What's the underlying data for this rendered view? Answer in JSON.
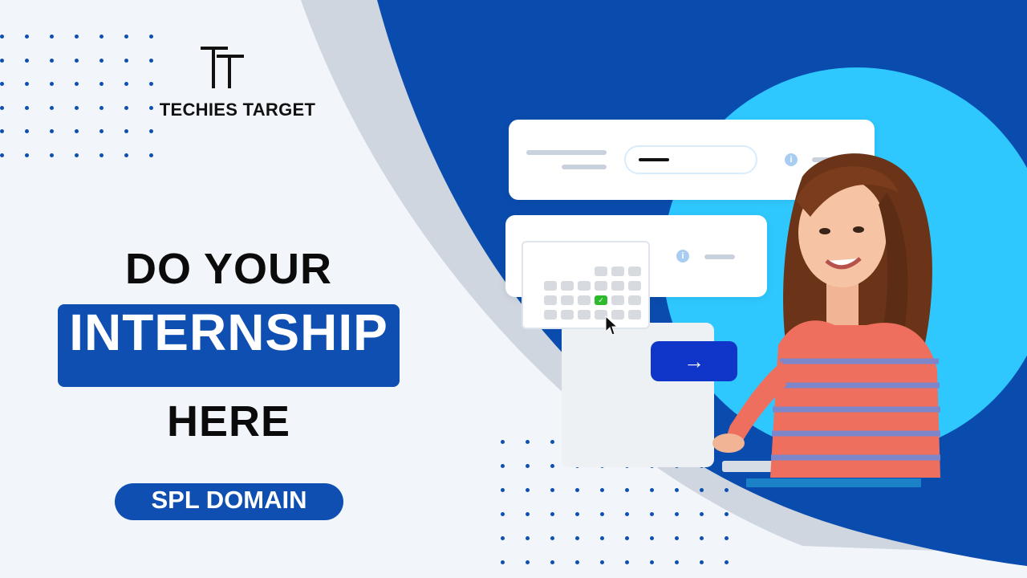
{
  "brand": {
    "logo_letters": "TT",
    "name": "TECHIES TARGET"
  },
  "headline": {
    "line1": "DO YOUR",
    "line2": "INTERNSHIP",
    "line3": "HERE"
  },
  "domain_label": "SPL DOMAIN",
  "illustration": {
    "info_glyph": "i",
    "check_glyph": "✓",
    "next_arrow": "→",
    "icons": [
      "info-icon",
      "check-icon",
      "cursor-icon",
      "arrow-right-icon"
    ]
  },
  "colors": {
    "brand_blue": "#0f4fb2",
    "dark_blue_panel": "#0a4cae",
    "light_blue_circle": "#2ec8ff",
    "grey_arc": "#cfd6df",
    "background": "#f2f6fb",
    "button_blue": "#0f35c9"
  }
}
